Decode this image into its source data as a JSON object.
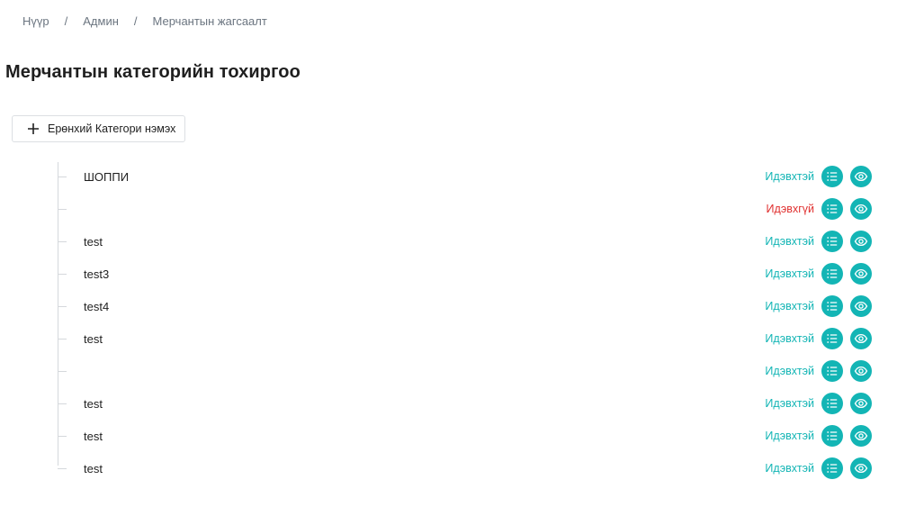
{
  "breadcrumb": {
    "items": [
      "Нүүр",
      "Админ",
      "Мерчантын жагсаалт"
    ],
    "separator": "/"
  },
  "page": {
    "title": "Мерчантын категорийн тохиргоо"
  },
  "actions": {
    "add_category_label": "Ерөнхий Категори нэмэх"
  },
  "colors": {
    "accent": "#13b5b5",
    "inactive": "#e0302f"
  },
  "categories": [
    {
      "name": "ШОППИ",
      "status": "Идэвхтэй",
      "active": true
    },
    {
      "name": "",
      "status": "Идэвхгүй",
      "active": false
    },
    {
      "name": "test",
      "status": "Идэвхтэй",
      "active": true
    },
    {
      "name": "test3",
      "status": "Идэвхтэй",
      "active": true
    },
    {
      "name": "test4",
      "status": "Идэвхтэй",
      "active": true
    },
    {
      "name": "test",
      "status": "Идэвхтэй",
      "active": true
    },
    {
      "name": "",
      "status": "Идэвхтэй",
      "active": true
    },
    {
      "name": "test",
      "status": "Идэвхтэй",
      "active": true
    },
    {
      "name": "test",
      "status": "Идэвхтэй",
      "active": true
    },
    {
      "name": "test",
      "status": "Идэвхтэй",
      "active": true
    }
  ],
  "row_icons": [
    "list-icon",
    "eye-icon"
  ]
}
